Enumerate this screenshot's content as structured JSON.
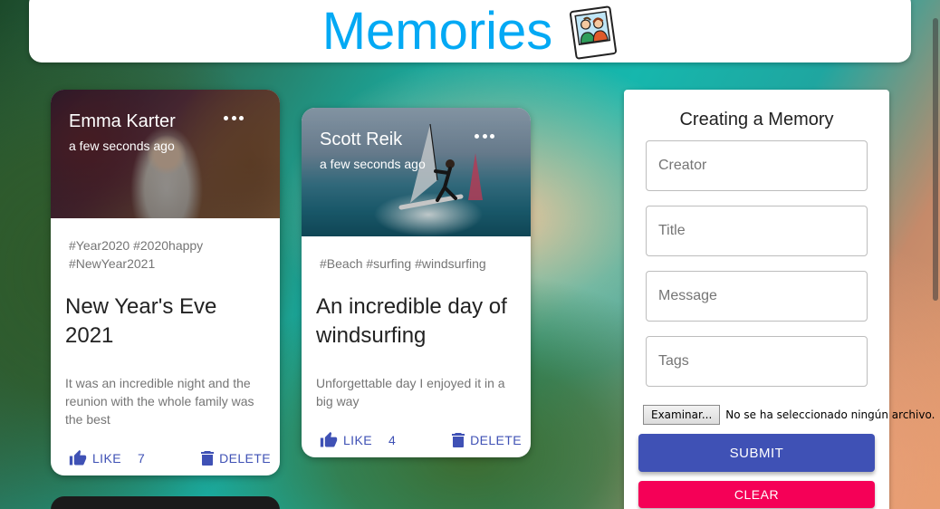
{
  "header": {
    "title": "Memories",
    "logo_icon": "memories-photo-icon",
    "title_color": "#03a9f4"
  },
  "posts": [
    {
      "creator": "Emma Karter",
      "time": "a few seconds ago",
      "tags_line1": "#Year2020 #2020happy",
      "tags_line2": "#NewYear2021",
      "title": "New Year's Eve 2021",
      "message": "It was an incredible night and the reunion with the whole family was the best",
      "like_label": "Like",
      "likes": "7",
      "delete_label": "Delete"
    },
    {
      "creator": "Scott Reik",
      "time": "a few seconds ago",
      "tags_line1": "#Beach #surfing #windsurfing",
      "title": "An incredible day of windsurfing",
      "message": "Unforgettable day I enjoyed it in a big way",
      "like_label": "Like",
      "likes": "4",
      "delete_label": "Delete"
    }
  ],
  "form": {
    "heading": "Creating a Memory",
    "creator_placeholder": "Creator",
    "title_placeholder": "Title",
    "message_placeholder": "Message",
    "tags_placeholder": "Tags",
    "file_button": "Examinar...",
    "file_status": "No se ha seleccionado ningún archivo.",
    "submit_label": "SUBMIT",
    "clear_label": "CLEAR"
  },
  "colors": {
    "primary": "#3f51b5",
    "secondary": "#f50057"
  }
}
